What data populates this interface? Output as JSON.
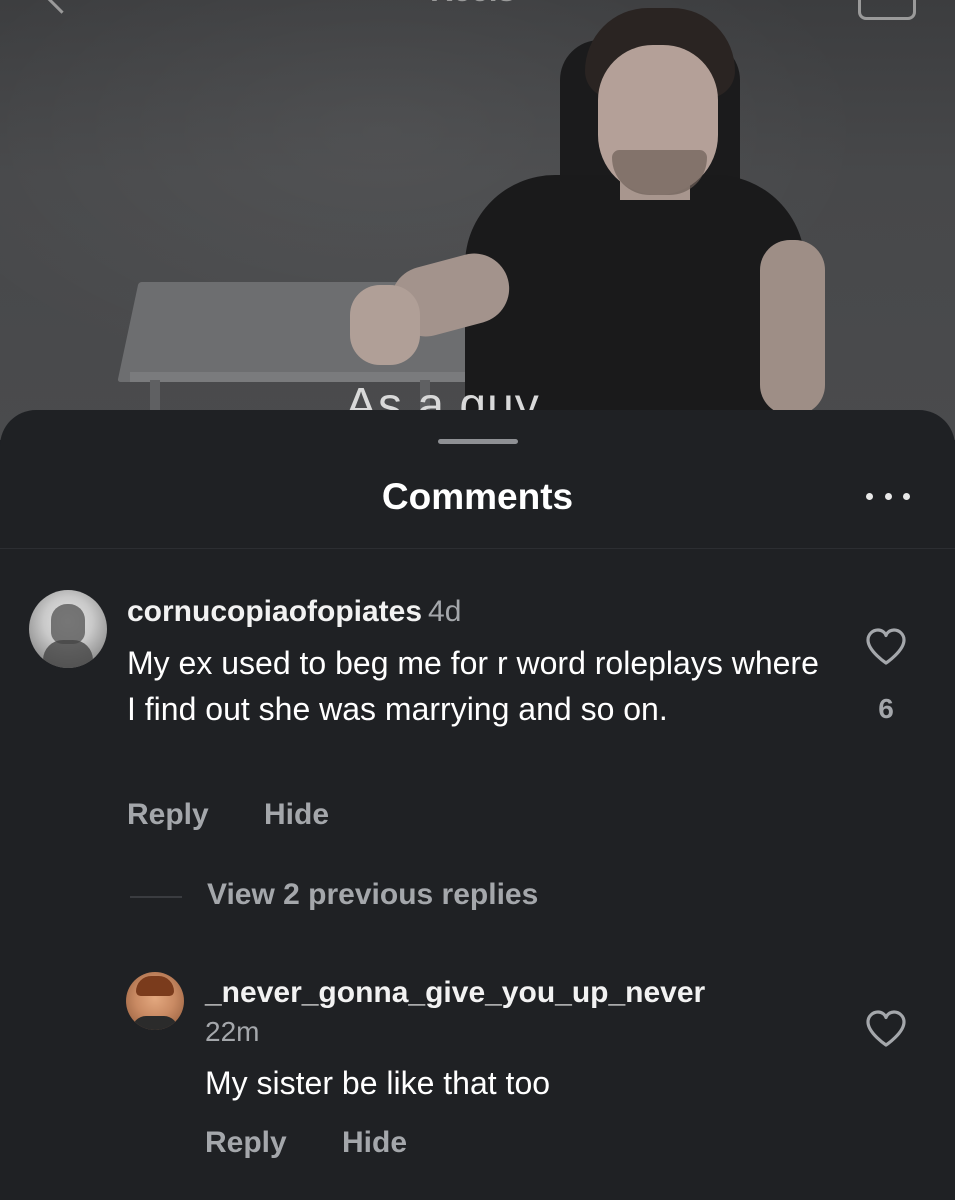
{
  "video": {
    "top_title": "Reels",
    "caption": "As a guy"
  },
  "sheet": {
    "title": "Comments"
  },
  "comments": [
    {
      "username": "cornucopiaofopiates",
      "time": "4d",
      "text": "My ex used to beg me for r word roleplays where I find out she was marrying and so on.",
      "reply_label": "Reply",
      "hide_label": "Hide",
      "likes": "6",
      "view_replies_label": "View 2 previous replies",
      "replies": [
        {
          "username": "_never_gonna_give_you_up_never",
          "time": "22m",
          "text": "My sister be like that too",
          "reply_label": "Reply",
          "hide_label": "Hide"
        }
      ]
    }
  ],
  "icons": {
    "more": "more-horizontal-icon",
    "like": "heart-outline-icon",
    "back": "chevron-left-icon",
    "camera": "camera-icon"
  },
  "colors": {
    "background": "#1f2124",
    "secondary_text": "#a4a7ab",
    "primary_text": "#ffffff"
  }
}
